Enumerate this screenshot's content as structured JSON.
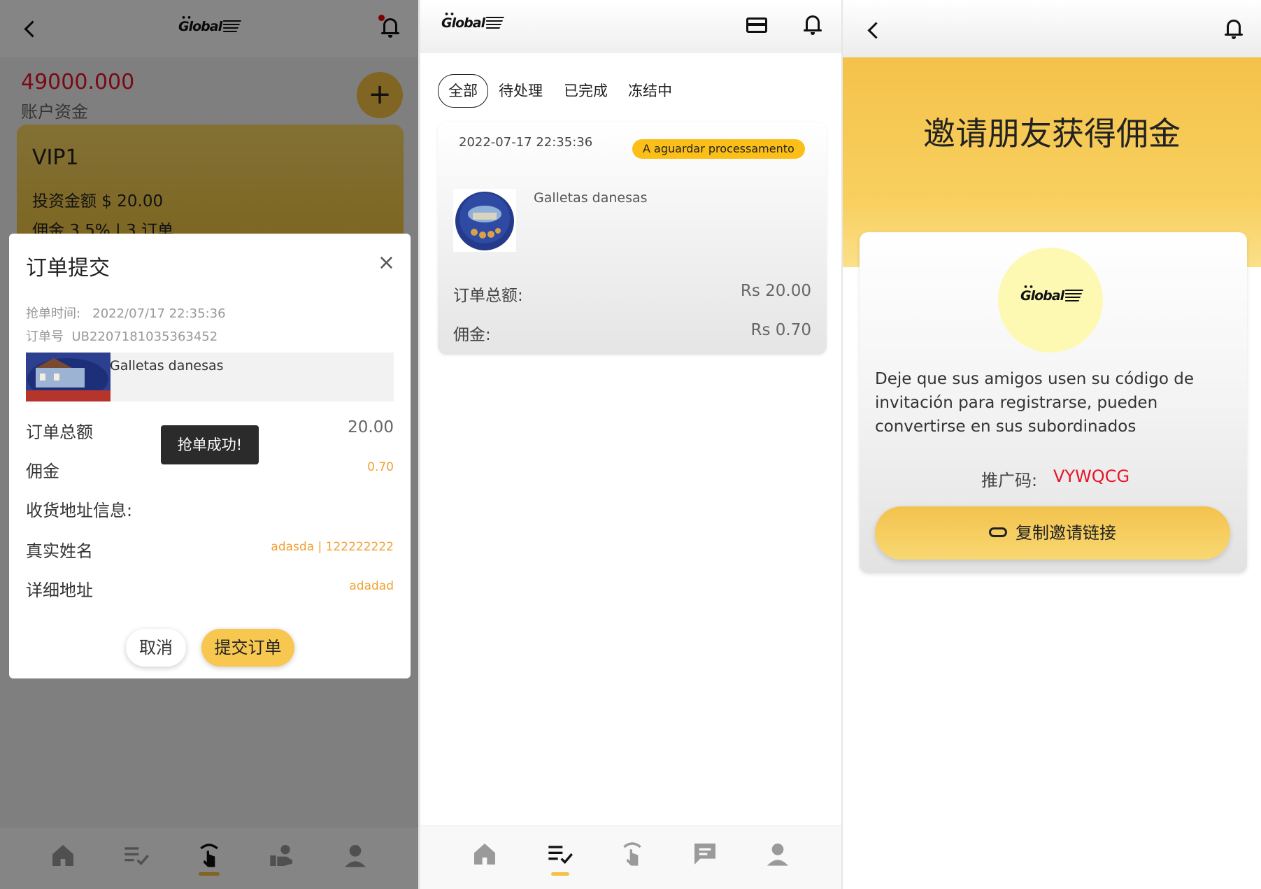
{
  "brand": {
    "logo_text": "Global"
  },
  "panel1": {
    "balance": "49000.000",
    "balance_label": "账户资金",
    "vip": {
      "title": "VIP1",
      "invest": "投资金额 $ 20.00",
      "commission": "佣金 3.5% | 3 订单"
    },
    "modal": {
      "title": "订单提交",
      "close": "×",
      "grab_time_label": "抢单时间:",
      "grab_time": "2022/07/17 22:35:36",
      "order_no_label": "订单号",
      "order_no": "UB2207181035363452",
      "product_name": "Galletas danesas",
      "total_label": "订单总额",
      "total_value": "20.00",
      "commission_label": "佣金",
      "commission_value": "0.70",
      "address_info_label": "收货地址信息:",
      "real_name_label": "真实姓名",
      "real_name_value": "adasda | 122222222",
      "detail_addr_label": "详细地址",
      "detail_addr_value": "adadad",
      "cancel_label": "取消",
      "submit_label": "提交订单"
    },
    "toast": "抢单成功!"
  },
  "panel2": {
    "tabs": [
      "全部",
      "待处理",
      "已完成",
      "冻结中"
    ],
    "order": {
      "datetime": "2022-07-17 22:35:36",
      "status": "A aguardar processamento",
      "product_name": "Galletas danesas",
      "total_label": "订单总额:",
      "total_value": "Rs 20.00",
      "commission_label": "佣金:",
      "commission_value": "Rs 0.70"
    }
  },
  "panel3": {
    "title": "邀请朋友获得佣金",
    "description": "Deje que sus amigos usen su código de invitación para registrarse, pueden convertirse en sus subordinados",
    "promo_label": "推广码:",
    "promo_code": "VYWQCG",
    "copy_button": "复制邀请链接"
  },
  "colors": {
    "accent": "#f5c144",
    "balance_red": "#e8142a",
    "status_badge": "#fbbf17",
    "commission_orange": "#f0a233"
  },
  "icons": [
    "back-arrow-icon",
    "bell-icon",
    "plus-icon",
    "card-icon",
    "home-icon",
    "order-list-icon",
    "grab-order-icon",
    "deposit-icon",
    "message-icon",
    "profile-icon",
    "link-icon"
  ]
}
